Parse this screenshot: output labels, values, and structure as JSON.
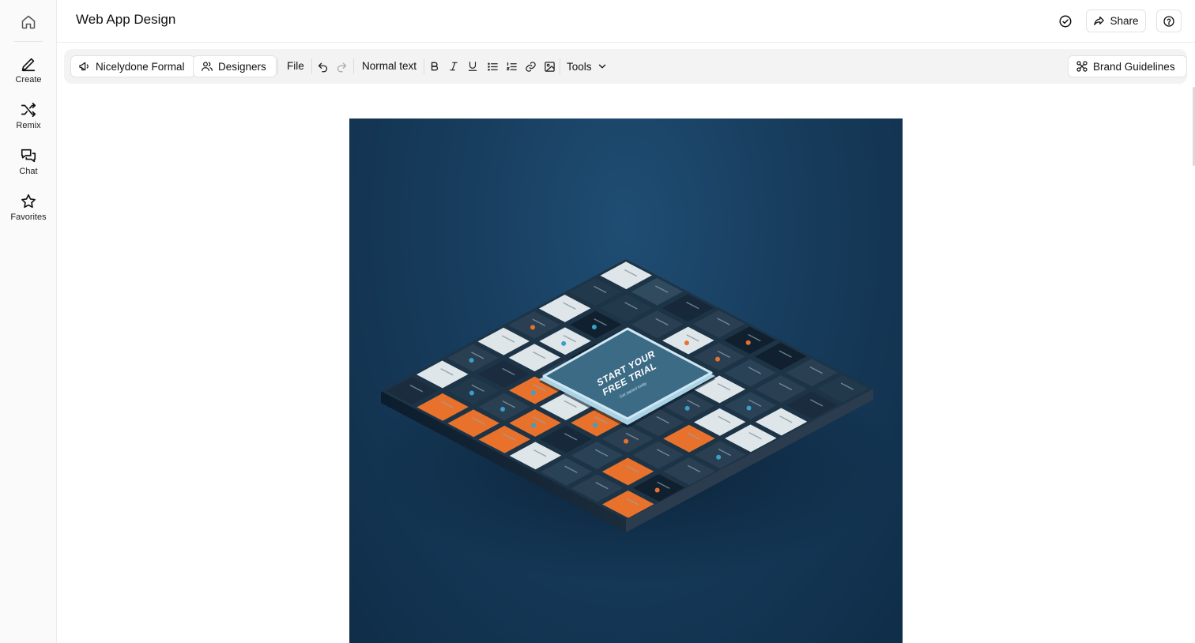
{
  "rail": {
    "home_icon": "home-icon",
    "items": [
      {
        "label": "Create",
        "icon": "pen-icon"
      },
      {
        "label": "Remix",
        "icon": "shuffle-icon"
      },
      {
        "label": "Chat",
        "icon": "chat-bubbles-icon"
      },
      {
        "label": "Favorites",
        "icon": "star-icon"
      }
    ]
  },
  "header": {
    "title": "Web App Design",
    "share_label": "Share",
    "status_icon": "check-circle-icon",
    "help_icon": "help-circle-icon"
  },
  "toolbar": {
    "voice_label": "Nicelydone Formal",
    "audience_label": "Designers",
    "file_label": "File",
    "text_style_label": "Normal text",
    "tools_label": "Tools",
    "brand_label": "Brand Guidelines"
  },
  "canvas": {
    "headline": "START YOUR FREE TRIAL",
    "subline": "Get started today",
    "colors": {
      "background": "#173c5c",
      "accent": "#e8722c",
      "card": "#2b3f52",
      "light": "#dfe6ea"
    }
  }
}
